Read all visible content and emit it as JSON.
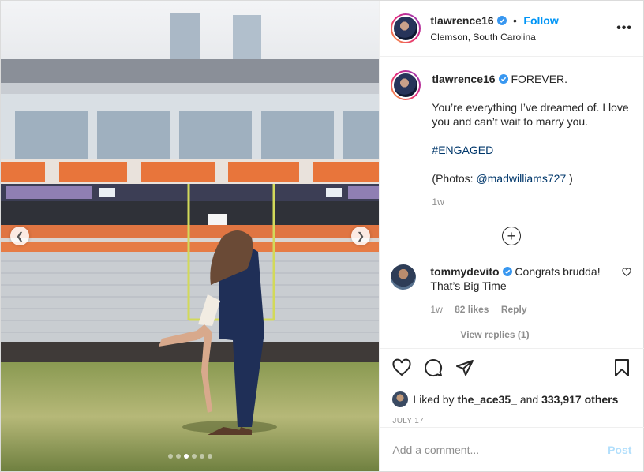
{
  "header": {
    "username": "tlawrence16",
    "separator": "•",
    "follow_label": "Follow",
    "location": "Clemson, South Carolina",
    "more_label": "•••"
  },
  "caption": {
    "username": "tlawrence16",
    "line1": "FOREVER.",
    "line2": "You’re everything I’ve dreamed of. I love you and can’t wait to marry you.",
    "hashtag": "#ENGAGED",
    "photos_prefix": "(Photos: ",
    "photos_mention": "@madwilliams727",
    "photos_suffix": " )",
    "time": "1w"
  },
  "load_more_label": "+",
  "comment": {
    "username": "tommydevito",
    "text": "Congrats brudda! That’s Big Time",
    "time": "1w",
    "likes": "82 likes",
    "reply_label": "Reply",
    "view_replies": "View replies (1)"
  },
  "likes": {
    "prefix": "Liked by ",
    "user": "the_ace35_",
    "middle": " and ",
    "count": "333,917 others"
  },
  "date": "JULY 17",
  "comment_box": {
    "placeholder": "Add a comment...",
    "post_label": "Post"
  },
  "carousel": {
    "total": 6,
    "active": 2
  },
  "colors": {
    "accent": "#0095f6",
    "post_disabled": "#b2dffc",
    "link": "#00376b"
  }
}
